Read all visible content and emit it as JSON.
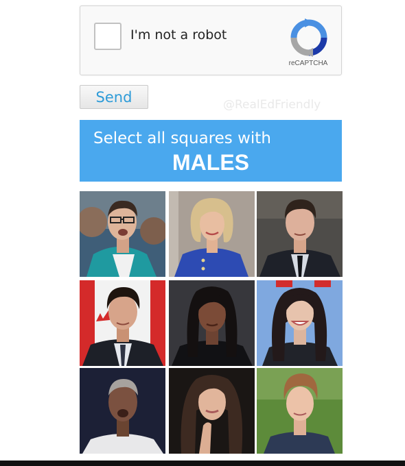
{
  "recaptcha": {
    "checkbox_label": "I'm not a robot",
    "brand": "reCAPTCHA",
    "logo_icon": "recaptcha-logo-icon"
  },
  "send_button": {
    "label": "Send"
  },
  "watermark": {
    "text": "@RealEdFriendly"
  },
  "challenge": {
    "instruction": "Select all squares with",
    "target": "MALES",
    "accent_color": "#4aa8ee"
  },
  "grid": {
    "rows": 3,
    "cols": 3,
    "tiles": [
      {
        "row": 1,
        "col": 1,
        "content": "photo-man-dark-hair-glasses-teal-shirt"
      },
      {
        "row": 1,
        "col": 2,
        "content": "photo-woman-blonde-blue-jacket"
      },
      {
        "row": 1,
        "col": 3,
        "content": "photo-man-dark-suit"
      },
      {
        "row": 2,
        "col": 1,
        "content": "photo-man-dark-suit-flag-background"
      },
      {
        "row": 2,
        "col": 2,
        "content": "photo-woman-dark-hair"
      },
      {
        "row": 2,
        "col": 3,
        "content": "photo-woman-long-dark-hair-smiling"
      },
      {
        "row": 3,
        "col": 1,
        "content": "photo-man-grey-hair-speaking"
      },
      {
        "row": 3,
        "col": 2,
        "content": "photo-woman-dark-hair-hand-on-chin"
      },
      {
        "row": 3,
        "col": 3,
        "content": "photo-young-man-brown-hair-outdoors"
      }
    ]
  }
}
